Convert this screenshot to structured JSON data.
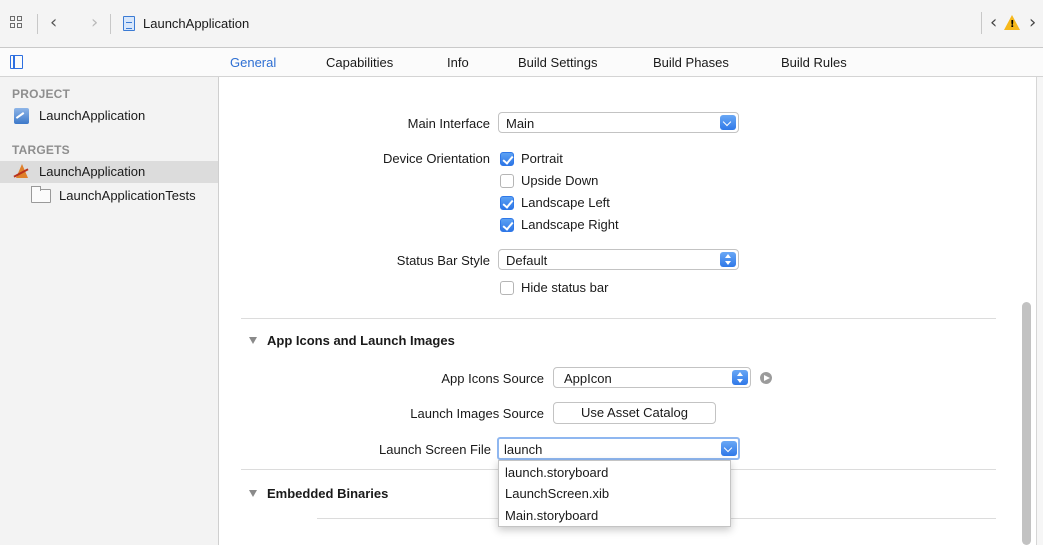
{
  "jumpbar": {
    "title": "LaunchApplication",
    "icons": [
      "grid-icon",
      "back-chevron-icon",
      "forward-chevron-icon",
      "project-file-icon",
      "warning-icon"
    ],
    "warning_color": "#f6b81b"
  },
  "tabs": [
    {
      "label": "General",
      "active": true
    },
    {
      "label": "Capabilities",
      "active": false
    },
    {
      "label": "Info",
      "active": false
    },
    {
      "label": "Build Settings",
      "active": false
    },
    {
      "label": "Build Phases",
      "active": false
    },
    {
      "label": "Build Rules",
      "active": false
    }
  ],
  "accent_color": "#2e6fd3",
  "navigator": {
    "project_header": "PROJECT",
    "project_item": "LaunchApplication",
    "targets_header": "TARGETS",
    "targets": [
      {
        "label": "LaunchApplication",
        "selected": true
      },
      {
        "label": "LaunchApplicationTests",
        "selected": false
      }
    ]
  },
  "deployment": {
    "main_interface_label": "Main Interface",
    "main_interface_value": "Main",
    "device_orientation_label": "Device Orientation",
    "orientations": [
      {
        "label": "Portrait",
        "checked": true
      },
      {
        "label": "Upside Down",
        "checked": false
      },
      {
        "label": "Landscape Left",
        "checked": true
      },
      {
        "label": "Landscape Right",
        "checked": true
      }
    ],
    "status_bar_style_label": "Status Bar Style",
    "status_bar_style_value": "Default",
    "hide_status_bar_label": "Hide status bar",
    "hide_status_bar_checked": false
  },
  "app_icons": {
    "section_title": "App Icons and Launch Images",
    "icons_source_label": "App Icons Source",
    "icons_source_value": "AppIcon",
    "launch_images_source_label": "Launch Images Source",
    "use_asset_catalog_label": "Use Asset Catalog",
    "launch_screen_file_label": "Launch Screen File",
    "launch_screen_file_value": "launch",
    "launch_screen_options": [
      "launch.storyboard",
      "LaunchScreen.xib",
      "Main.storyboard"
    ]
  },
  "embedded": {
    "section_title": "Embedded Binaries"
  }
}
